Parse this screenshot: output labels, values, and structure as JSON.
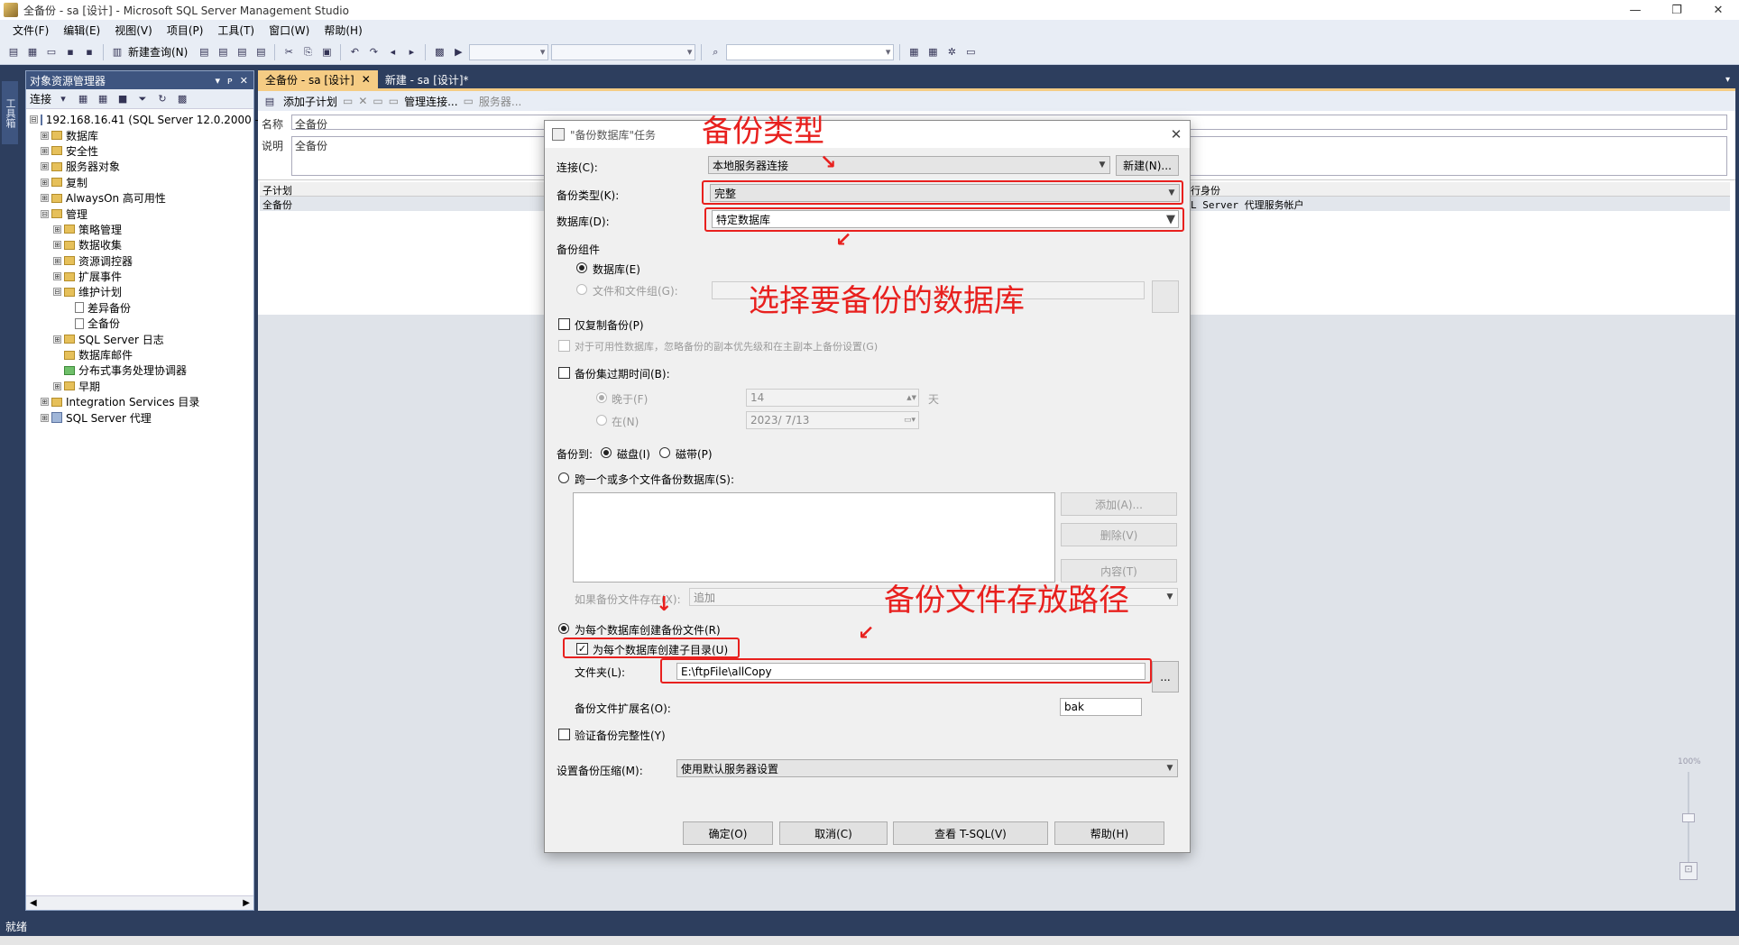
{
  "window": {
    "title": "全备份 - sa [设计] - Microsoft SQL Server Management Studio",
    "controls": [
      "—",
      "❐",
      "✕"
    ]
  },
  "menu": [
    "文件(F)",
    "编辑(E)",
    "视图(V)",
    "项目(P)",
    "工具(T)",
    "窗口(W)",
    "帮助(H)"
  ],
  "toolbar": {
    "new_query": "新建查询(N)"
  },
  "toolbox_tab": "工具箱",
  "object_explorer": {
    "title": "对象资源管理器",
    "header_controls": [
      "▾",
      "ᴘ",
      "✕"
    ],
    "connect": "连接",
    "nodes": [
      {
        "label": "192.168.16.41 (SQL Server 12.0.2000 -",
        "expand": "⊟"
      },
      {
        "label": "数据库",
        "expand": "⊞"
      },
      {
        "label": "安全性",
        "expand": "⊞"
      },
      {
        "label": "服务器对象",
        "expand": "⊞"
      },
      {
        "label": "复制",
        "expand": "⊞"
      },
      {
        "label": "AlwaysOn 高可用性",
        "expand": "⊞"
      },
      {
        "label": "管理",
        "expand": "⊟"
      },
      {
        "label": "策略管理",
        "expand": "⊞"
      },
      {
        "label": "数据收集",
        "expand": "⊞"
      },
      {
        "label": "资源调控器",
        "expand": "⊞"
      },
      {
        "label": "扩展事件",
        "expand": "⊞"
      },
      {
        "label": "维护计划",
        "expand": "⊟"
      },
      {
        "label": "差异备份",
        "expand": ""
      },
      {
        "label": "全备份",
        "expand": ""
      },
      {
        "label": "SQL Server 日志",
        "expand": "⊞"
      },
      {
        "label": "数据库邮件",
        "expand": ""
      },
      {
        "label": "分布式事务处理协调器",
        "expand": ""
      },
      {
        "label": "早期",
        "expand": "⊞"
      },
      {
        "label": "Integration Services 目录",
        "expand": "⊞"
      },
      {
        "label": "SQL Server 代理",
        "expand": "⊞"
      }
    ]
  },
  "tabs": [
    {
      "label": "全备份 - sa [设计]",
      "close": "✕"
    },
    {
      "label": "新建 - sa [设计]*"
    }
  ],
  "designer": {
    "add_subplan": "添加子计划",
    "manage_connections": "管理连接...",
    "servers": "服务器...",
    "name_label": "名称",
    "name_value": "全备份",
    "desc_label": "说明",
    "desc_value": "全备份",
    "grid_col_subplan": "子计划",
    "grid_row_value": "全备份",
    "grid_col_runas": "行身份",
    "grid_runas_value": "L Server 代理服务帐户"
  },
  "dialog": {
    "title": "\"备份数据库\"任务",
    "connection_label": "连接(C):",
    "connection_value": "本地服务器连接",
    "new_button": "新建(N)...",
    "backup_type_label": "备份类型(K):",
    "backup_type_value": "完整",
    "database_label": "数据库(D):",
    "database_value": "特定数据库",
    "component_label": "备份组件",
    "component_db": "数据库(E)",
    "component_files": "文件和文件组(G):",
    "copy_only": "仅复制备份(P)",
    "copy_only_note": "对于可用性数据库，忽略备份的副本优先级和在主副本上备份设置(G)",
    "expire_label": "备份集过期时间(B):",
    "expire_after": "晚于(F)",
    "expire_after_value": "14",
    "expire_days": "天",
    "expire_on": "在(N)",
    "expire_on_value": "2023/ 7/13",
    "backup_to_label": "备份到:",
    "backup_to_disk": "磁盘(I)",
    "backup_to_tape": "磁带(P)",
    "span_files": "跨一个或多个文件备份数据库(S):",
    "add_button": "添加(A)...",
    "remove_button": "删除(V)",
    "contents_button": "内容(T)",
    "if_exists_label": "如果备份文件存在(X):",
    "if_exists_value": "追加",
    "per_db_file": "为每个数据库创建备份文件(R)",
    "per_db_subdir": "为每个数据库创建子目录(U)",
    "folder_label": "文件夹(L):",
    "folder_value": "E:\\ftpFile\\allCopy",
    "browse_button": "...",
    "ext_label": "备份文件扩展名(O):",
    "ext_value": "bak",
    "verify": "验证备份完整性(Y)",
    "compression_label": "设置备份压缩(M):",
    "compression_value": "使用默认服务器设置",
    "ok": "确定(O)",
    "cancel": "取消(C)",
    "view_tsql": "查看 T-SQL(V)",
    "help": "帮助(H)"
  },
  "annotations": {
    "backup_type": "备份类型",
    "choose_db": "选择要备份的数据库",
    "file_path": "备份文件存放路径",
    "color": "#e8201e"
  },
  "zoom": {
    "label": "100%"
  },
  "status": {
    "text": "就绪"
  }
}
